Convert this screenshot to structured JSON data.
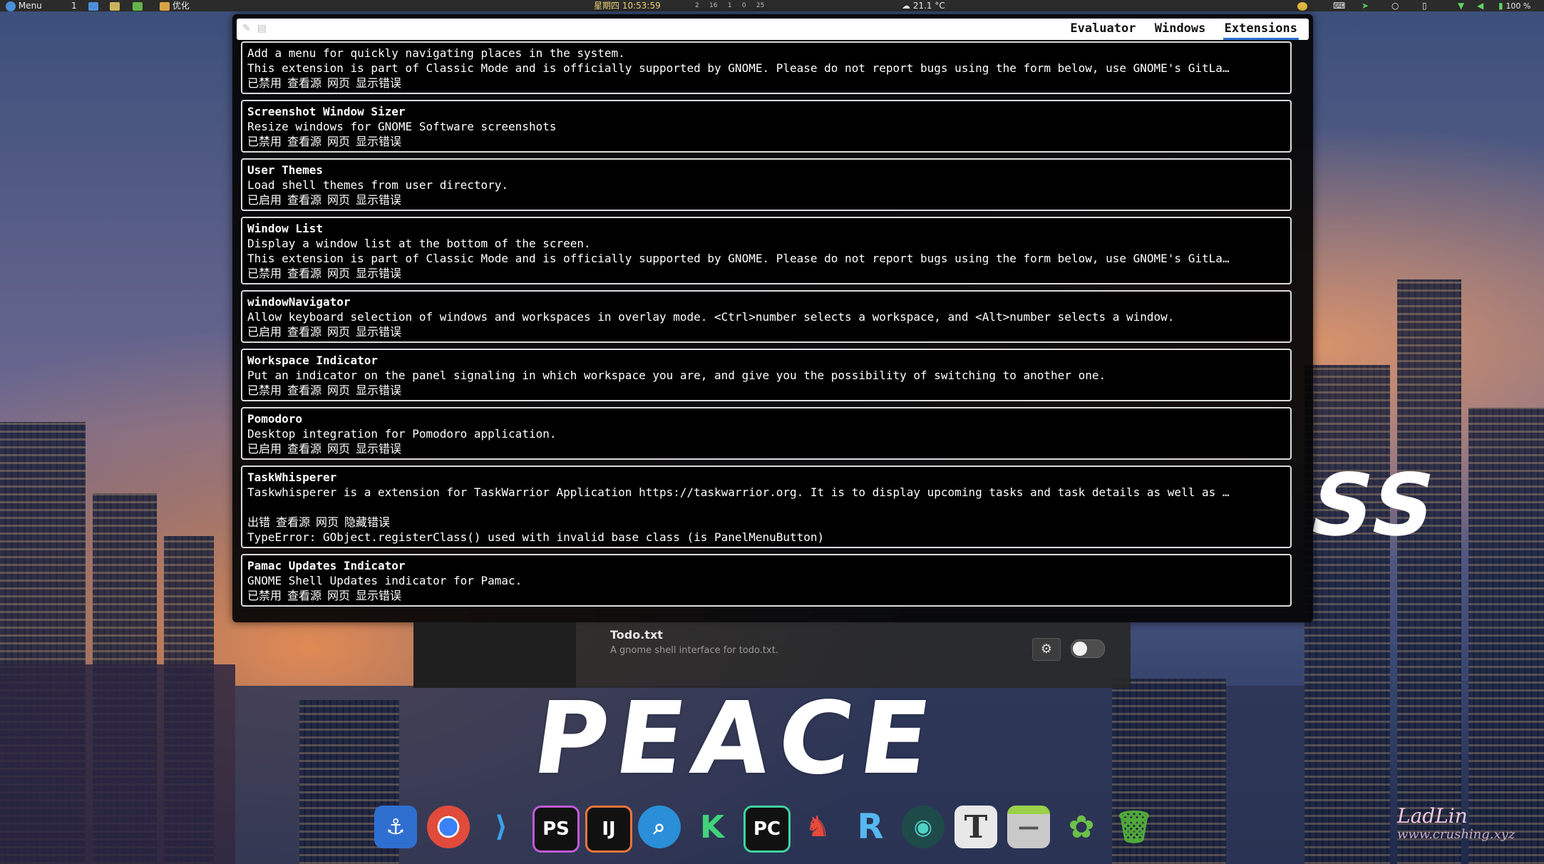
{
  "top_panel": {
    "menu_label": "Menu",
    "workspace": "1",
    "app_label": "优化",
    "clock": "星期四 10:53:59",
    "temperature": "21.1 °C",
    "battery": "100 %",
    "sys_metrics": [
      "2",
      "16",
      "1",
      "0",
      "25"
    ]
  },
  "looking_glass": {
    "tabs": [
      "Evaluator",
      "Windows",
      "Extensions"
    ],
    "active_tab": "Extensions",
    "extensions": [
      {
        "name": "",
        "desc": [
          "Add a menu for quickly navigating places in the system.",
          "This extension is part of Classic Mode and is officially supported by GNOME. Please do not report bugs using the form below, use GNOME's GitLa…"
        ],
        "state": "已禁用",
        "view_source": "查看源",
        "web_page": "网页",
        "errors": "显示错误"
      },
      {
        "name": "Screenshot Window Sizer",
        "desc": [
          "Resize windows for GNOME Software screenshots"
        ],
        "state": "已禁用",
        "view_source": "查看源",
        "web_page": "网页",
        "errors": "显示错误"
      },
      {
        "name": "User Themes",
        "desc": [
          "Load shell themes from user directory."
        ],
        "state": "已启用",
        "view_source": "查看源",
        "web_page": "网页",
        "errors": "显示错误"
      },
      {
        "name": "Window List",
        "desc": [
          "Display a window list at the bottom of the screen.",
          "This extension is part of Classic Mode and is officially supported by GNOME. Please do not report bugs using the form below, use GNOME's GitLa…"
        ],
        "state": "已禁用",
        "view_source": "查看源",
        "web_page": "网页",
        "errors": "显示错误"
      },
      {
        "name": "windowNavigator",
        "desc": [
          "Allow keyboard selection of windows and workspaces in overlay mode. <Ctrl>number selects a workspace, and <Alt>number selects a window."
        ],
        "state": "已启用",
        "view_source": "查看源",
        "web_page": "网页",
        "errors": "显示错误"
      },
      {
        "name": "Workspace Indicator",
        "desc": [
          "Put an indicator on the panel signaling in which workspace you are, and give you the possibility of switching to another one."
        ],
        "state": "已禁用",
        "view_source": "查看源",
        "web_page": "网页",
        "errors": "显示错误"
      },
      {
        "name": "Pomodoro",
        "desc": [
          "Desktop integration for Pomodoro application."
        ],
        "state": "已启用",
        "view_source": "查看源",
        "web_page": "网页",
        "errors": "显示错误"
      },
      {
        "name": "TaskWhisperer",
        "desc": [
          "Taskwhisperer is a extension for TaskWarrior Application https://taskwarrior.org. It is to display upcoming tasks and task details as well as …"
        ],
        "state": "出错",
        "view_source": "查看源",
        "web_page": "网页",
        "errors": "隐藏错误",
        "error_text": "TypeError: GObject.registerClass() used with invalid base class (is PanelMenuButton)"
      },
      {
        "name": "Pamac Updates Indicator",
        "desc": [
          "GNOME Shell Updates indicator for Pamac."
        ],
        "state": "已禁用",
        "view_source": "查看源",
        "web_page": "网页",
        "errors": "显示错误"
      }
    ]
  },
  "settings_row": {
    "title": "Todo.txt",
    "desc": "A gnome shell interface for todo.txt.",
    "enabled": false
  },
  "wallpaper": {
    "text_main": "PEACE",
    "text_side": "SS"
  },
  "watermark": {
    "name": "LadLin",
    "url": "www.crushing.xyz"
  },
  "dock": {
    "icons": [
      "anchor-icon",
      "chrome-icon",
      "vscode-icon",
      "phpstorm-icon",
      "intellij-icon",
      "search-app-icon",
      "kotlin-icon",
      "pycharm-icon",
      "stick-figure-icon",
      "r-icon",
      "gitkraken-icon",
      "typora-icon",
      "files-icon",
      "gnome-tweaks-icon",
      "trash-icon"
    ]
  }
}
